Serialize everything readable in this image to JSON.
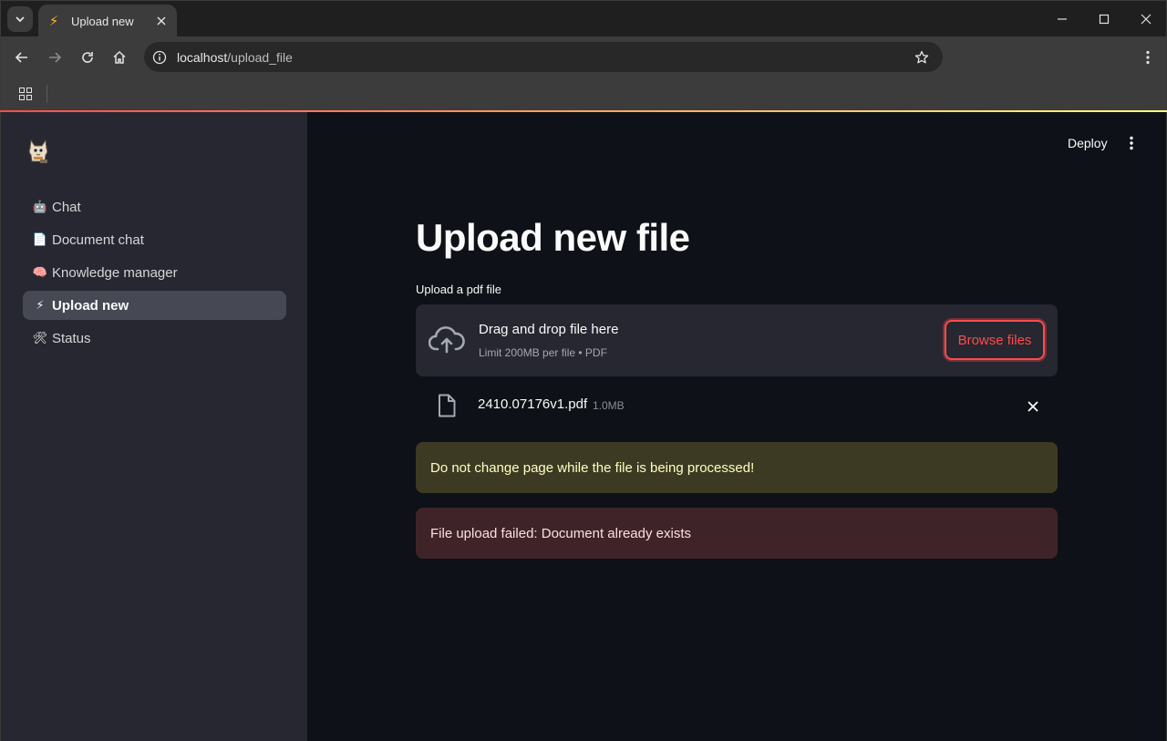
{
  "browser": {
    "tab_title": "Upload new",
    "url_host": "localhost",
    "url_path": "/upload_file"
  },
  "header": {
    "deploy_label": "Deploy"
  },
  "sidebar": {
    "items": [
      {
        "emoji": "🤖",
        "label": "Chat"
      },
      {
        "emoji": "📄",
        "label": "Document chat"
      },
      {
        "emoji": "🧠",
        "label": "Knowledge manager"
      },
      {
        "emoji": "⚡",
        "label": "Upload new"
      },
      {
        "emoji": "🛠",
        "label": "Status"
      }
    ],
    "active_index": 3
  },
  "main": {
    "title": "Upload new file",
    "uploader_label": "Upload a pdf file",
    "dropzone": {
      "title": "Drag and drop file here",
      "limits": "Limit 200MB per file • PDF",
      "browse_label": "Browse files"
    },
    "file": {
      "name": "2410.07176v1.pdf",
      "size": "1.0MB"
    },
    "warning": "Do not change page while the file is being processed!",
    "error": "File upload failed: Document already exists"
  },
  "colors": {
    "accent": "#ff4b4b",
    "sidebar_bg": "#262730",
    "main_bg": "#0e1117",
    "warning_bg": "#3d3a23",
    "error_bg": "#3e2428"
  }
}
